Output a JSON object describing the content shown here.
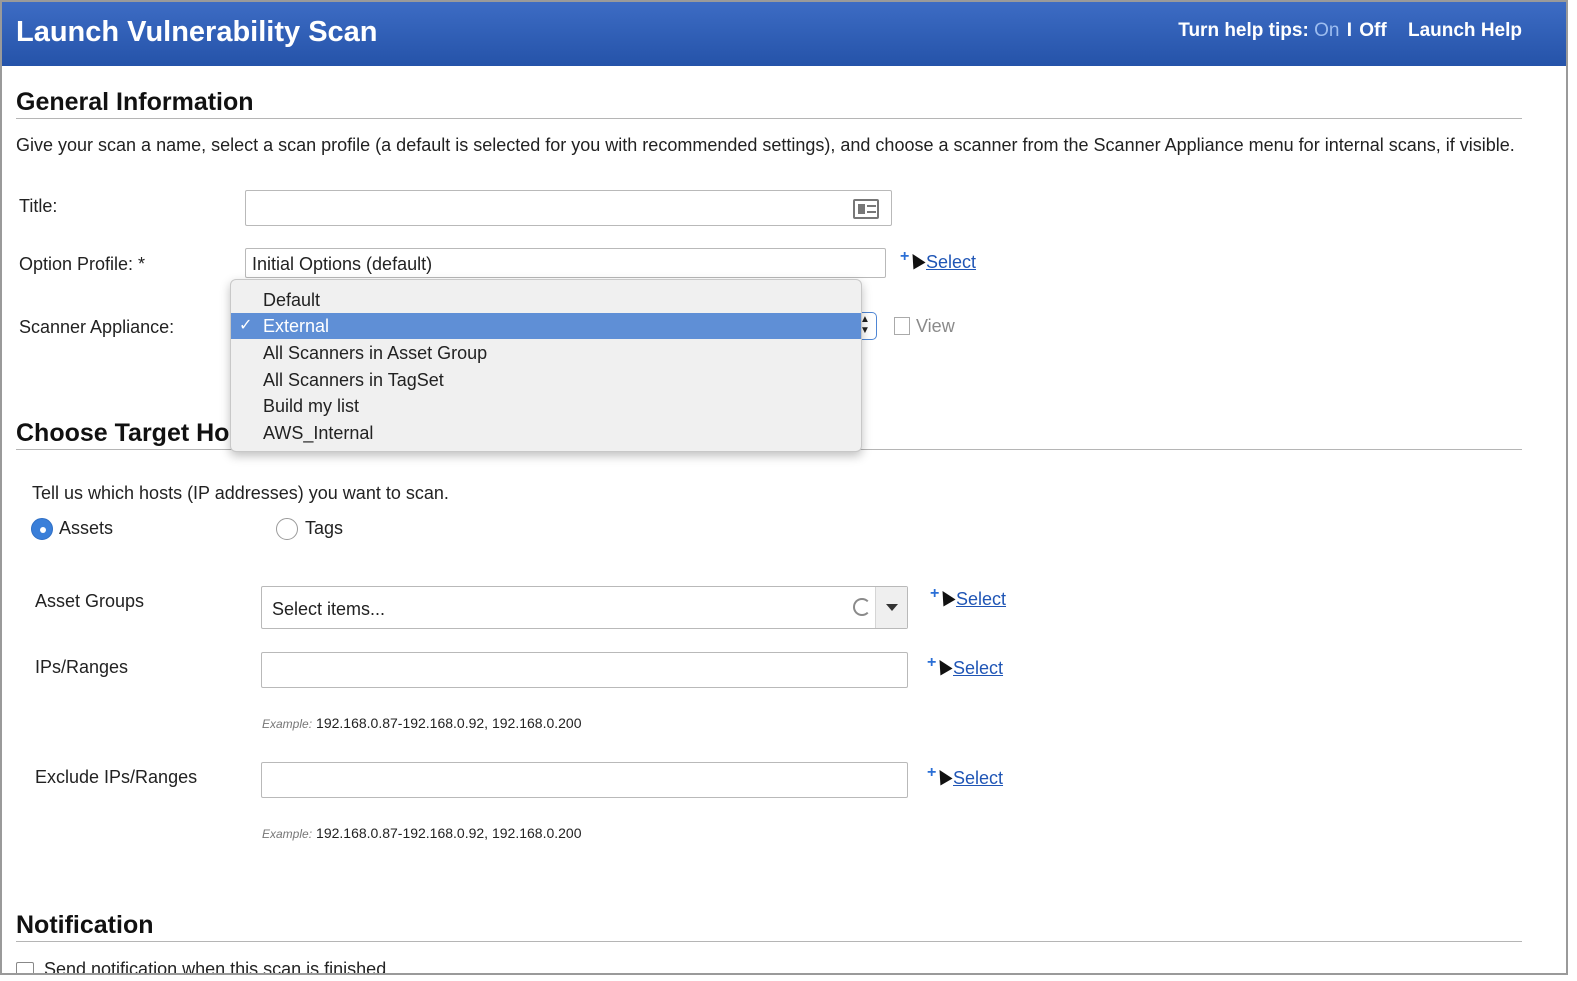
{
  "header": {
    "title": "Launch Vulnerability Scan",
    "help_tips_label": "Turn help tips:",
    "help_on": "On",
    "help_sep": "I",
    "help_off": "Off",
    "launch_help": "Launch Help"
  },
  "general": {
    "heading": "General Information",
    "description": "Give your scan a name, select a scan profile (a default is selected for you with recommended settings), and choose a scanner from the Scanner Appliance menu for internal scans, if visible.",
    "title_label": "Title:",
    "title_value": "",
    "option_profile_label": "Option Profile: *",
    "option_profile_value": "Initial Options (default)",
    "option_profile_select": "Select",
    "scanner_label": "Scanner Appliance:",
    "scanner_view": "View",
    "scanner_options": [
      "Default",
      "External",
      "All Scanners in Asset Group",
      "All Scanners in TagSet",
      "Build my list",
      "AWS_Internal"
    ],
    "scanner_selected": "External",
    "check_glyph": "✓"
  },
  "targets": {
    "heading": "Choose Target Ho",
    "instruction": "Tell us which hosts (IP addresses) you want to scan.",
    "radio_assets": "Assets",
    "radio_tags": "Tags",
    "asset_groups_label": "Asset Groups",
    "asset_groups_placeholder": "Select items...",
    "asset_groups_select": "Select",
    "ips_label": "IPs/Ranges",
    "ips_value": "",
    "ips_select": "Select",
    "ips_example_prefix": "Example:",
    "ips_example": "192.168.0.87-192.168.0.92, 192.168.0.200",
    "exclude_label": "Exclude IPs/Ranges",
    "exclude_value": "",
    "exclude_select": "Select",
    "exclude_example_prefix": "Example:",
    "exclude_example": "192.168.0.87-192.168.0.92, 192.168.0.200"
  },
  "notification": {
    "heading": "Notification",
    "checkbox_label": "Send notification when this scan is finished"
  },
  "colors": {
    "header_blue": "#2a5aad",
    "link_blue": "#1f55b5",
    "selected_option": "#5f8fd6"
  }
}
